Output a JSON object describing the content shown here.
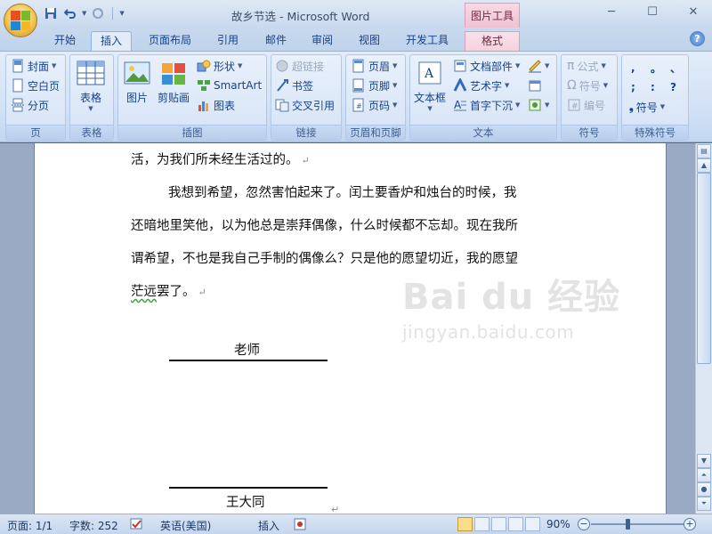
{
  "window": {
    "title": "故乡节选 - Microsoft Word",
    "context_group": "图片工具",
    "controls": [
      "─",
      "☐",
      "✕"
    ]
  },
  "tabs": [
    {
      "label": "开始",
      "active": false
    },
    {
      "label": "插入",
      "active": true
    },
    {
      "label": "页面布局",
      "active": false
    },
    {
      "label": "引用",
      "active": false
    },
    {
      "label": "邮件",
      "active": false
    },
    {
      "label": "审阅",
      "active": false
    },
    {
      "label": "视图",
      "active": false
    },
    {
      "label": "开发工具",
      "active": false
    },
    {
      "label": "格式",
      "active": false,
      "contextual": true
    }
  ],
  "ribbon": {
    "pages": {
      "label": "页",
      "items": [
        "封面",
        "空白页",
        "分页"
      ]
    },
    "tables": {
      "label": "表格",
      "button": "表格"
    },
    "illustrations": {
      "label": "插图",
      "picture": "图片",
      "clipart": "剪贴画",
      "shapes": "形状",
      "smartart": "SmartArt",
      "chart": "图表"
    },
    "links": {
      "label": "链接",
      "hyperlink": "超链接",
      "bookmark": "书签",
      "crossref": "交叉引用"
    },
    "headerfooter": {
      "label": "页眉和页脚",
      "header": "页眉",
      "footer": "页脚",
      "pagenum": "页码"
    },
    "text": {
      "label": "文本",
      "textbox": "文本框",
      "quickparts": "文档部件",
      "wordart": "艺术字",
      "dropcap": "首字下沉"
    },
    "symbols": {
      "label": "符号",
      "equation": "公式",
      "symbol": "符号",
      "numbering": "编号"
    },
    "special": {
      "label": "特殊符号",
      "chars": [
        ",",
        "。",
        "、",
        ";",
        ":",
        "?"
      ],
      "symbol": "符号"
    }
  },
  "document": {
    "line1": "活，为我们所未经生活过的。",
    "para2_lines": [
      "我想到希望，忽然害怕起来了。闰土要香炉和烛台的时候，我",
      "还暗地里笑他，以为他总是崇拜偶像，什么时候都不忘却。现在我所",
      "谓希望，不也是我自己手制的偶像么？只是他的愿望切近，我的愿望"
    ],
    "para2_last_wavy": "茫远",
    "para2_last_rest": "罢了。",
    "pilcrow": "↵",
    "sig_top": "老师",
    "sig_bottom": "王大同"
  },
  "watermark": {
    "brand": "Bai du 经验",
    "url": "jingyan.baidu.com"
  },
  "status": {
    "page": "页面: 1/1",
    "words": "字数: 252",
    "language": "英语(美国)",
    "mode": "插入",
    "zoom": "90%",
    "zoom_level": 0.4
  }
}
